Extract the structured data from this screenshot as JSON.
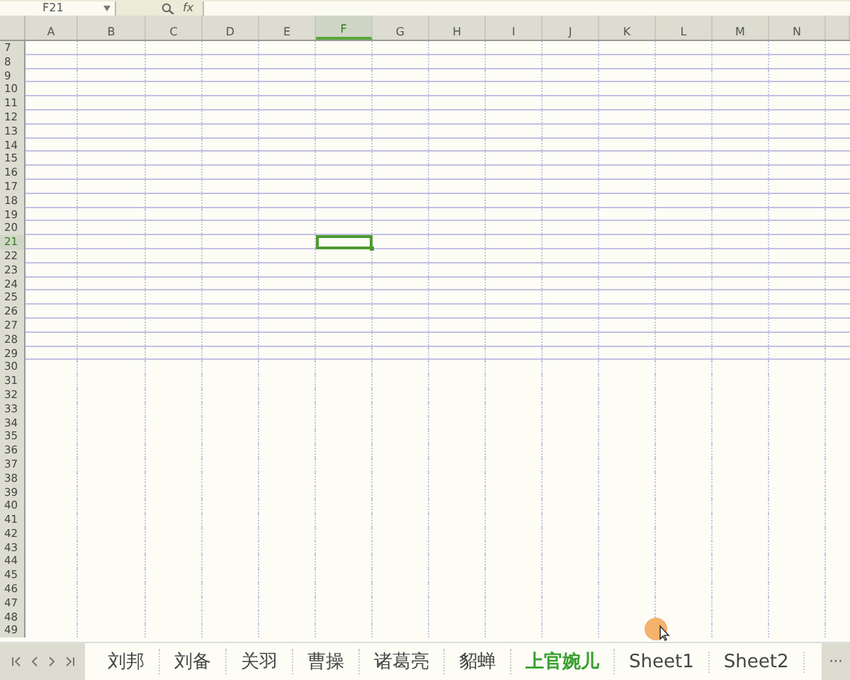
{
  "name_box": {
    "value": "F21"
  },
  "formula_bar": {
    "fx": "fx"
  },
  "columns": [
    {
      "label": "A",
      "selected": false
    },
    {
      "label": "B",
      "selected": false
    },
    {
      "label": "C",
      "selected": false
    },
    {
      "label": "D",
      "selected": false
    },
    {
      "label": "E",
      "selected": false
    },
    {
      "label": "F",
      "selected": true
    },
    {
      "label": "G",
      "selected": false
    },
    {
      "label": "H",
      "selected": false
    },
    {
      "label": "I",
      "selected": false
    },
    {
      "label": "J",
      "selected": false
    },
    {
      "label": "K",
      "selected": false
    },
    {
      "label": "L",
      "selected": false
    },
    {
      "label": "M",
      "selected": false
    },
    {
      "label": "N",
      "selected": false
    }
  ],
  "rows": [
    {
      "label": "7",
      "selected": false,
      "bordered": true
    },
    {
      "label": "8",
      "selected": false,
      "bordered": true
    },
    {
      "label": "9",
      "selected": false,
      "bordered": true
    },
    {
      "label": "10",
      "selected": false,
      "bordered": true
    },
    {
      "label": "11",
      "selected": false,
      "bordered": true
    },
    {
      "label": "12",
      "selected": false,
      "bordered": true
    },
    {
      "label": "13",
      "selected": false,
      "bordered": true
    },
    {
      "label": "14",
      "selected": false,
      "bordered": true
    },
    {
      "label": "15",
      "selected": false,
      "bordered": true
    },
    {
      "label": "16",
      "selected": false,
      "bordered": true
    },
    {
      "label": "17",
      "selected": false,
      "bordered": true
    },
    {
      "label": "18",
      "selected": false,
      "bordered": true
    },
    {
      "label": "19",
      "selected": false,
      "bordered": true
    },
    {
      "label": "20",
      "selected": false,
      "bordered": true
    },
    {
      "label": "21",
      "selected": true,
      "bordered": true
    },
    {
      "label": "22",
      "selected": false,
      "bordered": true
    },
    {
      "label": "23",
      "selected": false,
      "bordered": true
    },
    {
      "label": "24",
      "selected": false,
      "bordered": true
    },
    {
      "label": "25",
      "selected": false,
      "bordered": true
    },
    {
      "label": "26",
      "selected": false,
      "bordered": true
    },
    {
      "label": "27",
      "selected": false,
      "bordered": true
    },
    {
      "label": "28",
      "selected": false,
      "bordered": true
    },
    {
      "label": "29",
      "selected": false,
      "bordered": true
    },
    {
      "label": "30",
      "selected": false,
      "bordered": false
    },
    {
      "label": "31",
      "selected": false,
      "bordered": false
    },
    {
      "label": "32",
      "selected": false,
      "bordered": false
    },
    {
      "label": "33",
      "selected": false,
      "bordered": false
    },
    {
      "label": "34",
      "selected": false,
      "bordered": false
    },
    {
      "label": "35",
      "selected": false,
      "bordered": false
    },
    {
      "label": "36",
      "selected": false,
      "bordered": false
    },
    {
      "label": "37",
      "selected": false,
      "bordered": false
    },
    {
      "label": "38",
      "selected": false,
      "bordered": false
    },
    {
      "label": "39",
      "selected": false,
      "bordered": false
    },
    {
      "label": "40",
      "selected": false,
      "bordered": false
    },
    {
      "label": "41",
      "selected": false,
      "bordered": false
    },
    {
      "label": "42",
      "selected": false,
      "bordered": false
    },
    {
      "label": "43",
      "selected": false,
      "bordered": false
    },
    {
      "label": "44",
      "selected": false,
      "bordered": false
    },
    {
      "label": "45",
      "selected": false,
      "bordered": false
    },
    {
      "label": "46",
      "selected": false,
      "bordered": false
    },
    {
      "label": "47",
      "selected": false,
      "bordered": false
    },
    {
      "label": "48",
      "selected": false,
      "bordered": false
    },
    {
      "label": "49",
      "selected": false,
      "bordered": false
    }
  ],
  "sheet_tabs": [
    {
      "label": "刘邦",
      "selected": false
    },
    {
      "label": "刘备",
      "selected": false
    },
    {
      "label": "关羽",
      "selected": false
    },
    {
      "label": "曹操",
      "selected": false
    },
    {
      "label": "诸葛亮",
      "selected": false
    },
    {
      "label": "貂蝉",
      "selected": false
    },
    {
      "label": "上官婉儿",
      "selected": true
    },
    {
      "label": "Sheet1",
      "selected": false
    },
    {
      "label": "Sheet2",
      "selected": false
    }
  ],
  "more_tabs": "···"
}
